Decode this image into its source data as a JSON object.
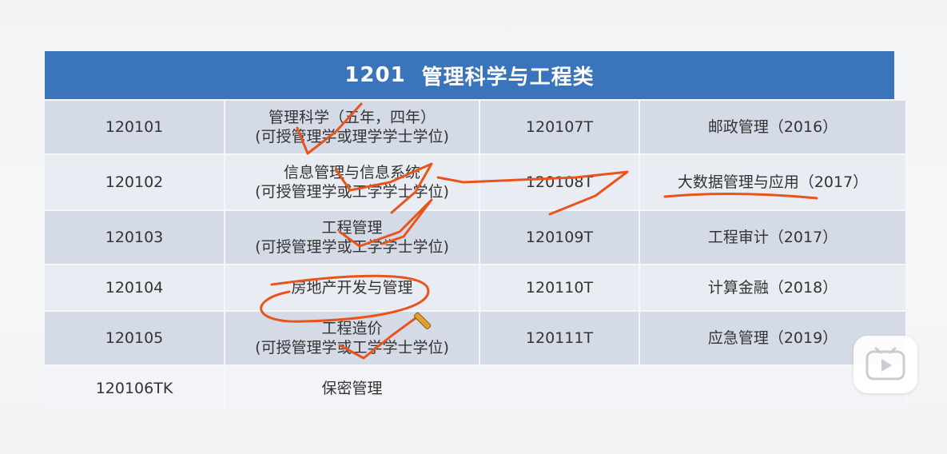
{
  "table": {
    "title_code": "1201",
    "title_text": "管理科学与工程类",
    "rows": [
      {
        "code1": "120101",
        "name1": "管理科学（五年，四年）",
        "note1": "(可授管理学或理学学士学位)",
        "code2": "120107T",
        "name2": "邮政管理（2016）"
      },
      {
        "code1": "120102",
        "name1": "信息管理与信息系统",
        "note1": "(可授管理学或工学学士学位)",
        "code2": "120108T",
        "name2": "大数据管理与应用（2017）"
      },
      {
        "code1": "120103",
        "name1": "工程管理",
        "note1": "(可授管理学或工学学士学位)",
        "code2": "120109T",
        "name2": "工程审计（2017）"
      },
      {
        "code1": "120104",
        "name1": "房地产开发与管理",
        "note1": "",
        "code2": "120110T",
        "name2": "计算金融（2018）"
      },
      {
        "code1": "120105",
        "name1": "工程造价",
        "note1": "(可授管理学或工学学士学位)",
        "code2": "120111T",
        "name2": "应急管理（2019）"
      },
      {
        "code1": "120106TK",
        "name1": "保密管理",
        "note1": "",
        "code2": "",
        "name2": ""
      }
    ]
  },
  "colors": {
    "header_bg": "#3a74bb",
    "row_dark": "#d5dbe6",
    "row_light": "#e9ecf2",
    "annotation": "#e8541c"
  },
  "icons": {
    "play": "play-button-icon",
    "pen": "pencil-cursor-icon"
  }
}
